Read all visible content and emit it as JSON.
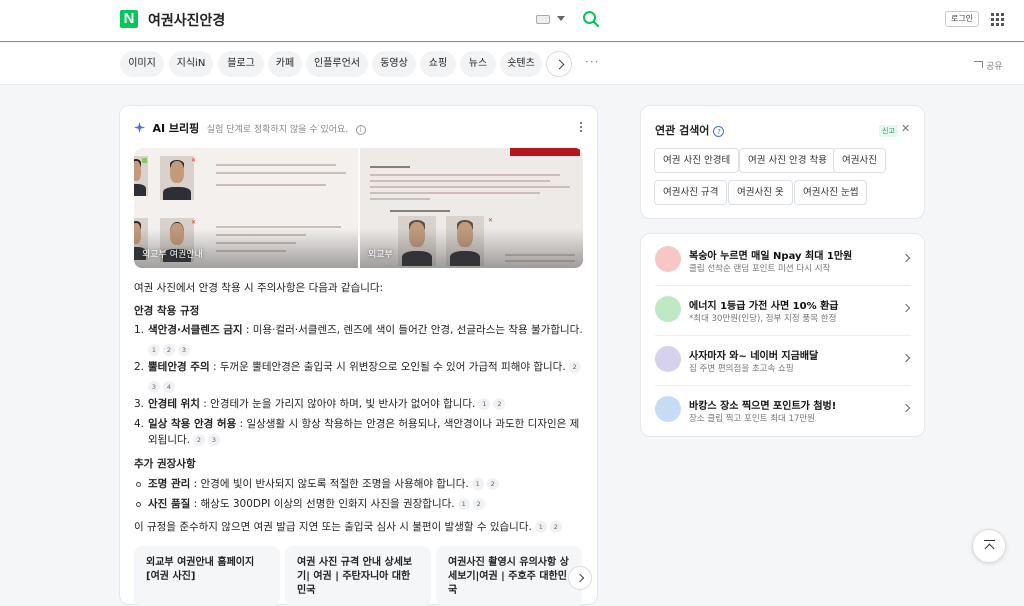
{
  "header": {
    "logo": "N",
    "query": "여권사진안경",
    "login_label": "로그인"
  },
  "tabs": [
    "이미지",
    "지식iN",
    "블로그",
    "카페",
    "인플루언서",
    "동영상",
    "쇼핑",
    "뉴스",
    "숏텐츠"
  ],
  "more_label": "···",
  "share_label": "공유",
  "ai_briefing": {
    "title": "AI 브리핑",
    "subtitle": "실험 단계로 정확하지 않을 수 있어요.",
    "thumbnails": [
      {
        "label": "외교부 여권안내"
      },
      {
        "label": "외교부"
      }
    ],
    "intro": "여권 사진에서 안경 착용 시 주의사항은 다음과 같습니다:",
    "section1_title": "안경 착용 규정",
    "rules": [
      {
        "num": "1.",
        "bold": "색안경·서클렌즈 금지",
        "text": " : 미용·컬러·서클렌즈, 렌즈에 색이 들어간 안경, 선글라스는 착용 불가합니다.",
        "cites": [
          "1",
          "2",
          "3"
        ]
      },
      {
        "num": "2.",
        "bold": "뿔테안경 주의",
        "text": " : 두꺼운 뿔테안경은 출입국 시 위변장으로 오인될 수 있어 가급적 피해야 합니다.",
        "cites": [
          "2",
          "3",
          "4"
        ]
      },
      {
        "num": "3.",
        "bold": "안경테 위치",
        "text": " : 안경테가 눈을 가리지 않아야 하며, 빛 반사가 없어야 합니다.",
        "cites": [
          "1",
          "2"
        ]
      },
      {
        "num": "4.",
        "bold": "일상 착용 안경 허용",
        "text": " : 일상생활 시 항상 착용하는 안경은 허용되나, 색안경이나 과도한 디자인은 제외됩니다.",
        "cites": [
          "2",
          "3"
        ]
      }
    ],
    "section2_title": "추가 권장사항",
    "extras": [
      {
        "bold": "조명 관리",
        "text": " : 안경에 빛이 반사되지 않도록 적절한 조명을 사용해야 합니다.",
        "cites": [
          "1",
          "2"
        ]
      },
      {
        "bold": "사진 품질",
        "text": " : 해상도 300DPI 이상의 선명한 인화지 사진을 권장합니다.",
        "cites": [
          "1",
          "2"
        ]
      }
    ],
    "conclusion": "이 규정을 준수하지 않으면 여권 발급 지연 또는 출입국 심사 시 불편이 발생할 수 있습니다.",
    "conclusion_cites": [
      "1",
      "2"
    ],
    "sources": [
      "외교부 여권안내 홈페이지 [여권 사진]",
      "여권 사진 규격 안내 상세보기| 여권 | 주탄자니아 대한민국",
      "여권사진 촬영시 유의사항 상세보기|여권 | 주호주 대한민국"
    ]
  },
  "related": {
    "title": "연관 검색어",
    "report_label": "신고",
    "chips": [
      "여권 사진 안경테",
      "여권 사진 안경 착용",
      "여권사진",
      "여권사진 규격",
      "여권사진 옷",
      "여권사진 눈썹"
    ]
  },
  "ads": [
    {
      "title": "복숭아 누르면 매일 Npay 최대 1만원",
      "desc": "클립 선착순 랜덤 포인트 미션 다시 시작",
      "color": "#f7c6c6"
    },
    {
      "title": "에너지 1등급 가전 사면 10% 환급",
      "desc": "*최대 30만원(인당), 정부 지정 품목 한정",
      "color": "#bfe8c4"
    },
    {
      "title": "사자마자 와~ 네이버 지금배달",
      "desc": "집 주변 편의점을 초고속 쇼핑",
      "color": "#d6d2ee"
    },
    {
      "title": "바캉스 장소 찍으면 포인트가 첨벙!",
      "desc": "장소 클립 찍고 포인트 최대 17만원",
      "color": "#c6dcf5"
    }
  ],
  "colors": {
    "brand": "#03c75a",
    "accent": "#4a6ee0"
  }
}
